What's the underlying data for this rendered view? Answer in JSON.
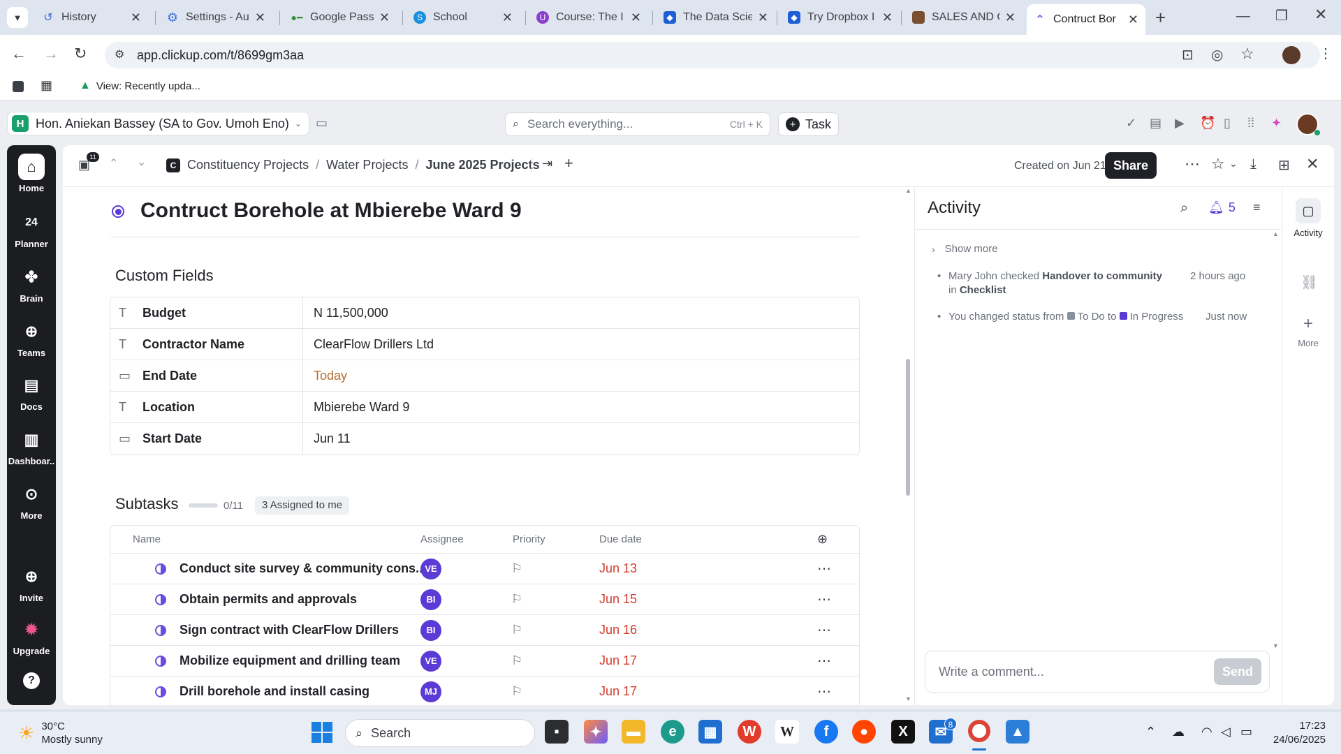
{
  "browser": {
    "tabs": [
      {
        "title": "History",
        "icon": "history-icon",
        "color": "#3b6fd9"
      },
      {
        "title": "Settings - Au",
        "icon": "gear-icon",
        "color": "#3b6fd9"
      },
      {
        "title": "Google Passw",
        "icon": "key-icon",
        "color": "#3c8d40"
      },
      {
        "title": "School",
        "icon": "skype-icon",
        "color": "#1a8fe0"
      },
      {
        "title": "Course: The I",
        "icon": "udemy-icon",
        "color": "#8b3fd1"
      },
      {
        "title": "The Data Scie",
        "icon": "dropbox-icon",
        "color": "#1f5fd6"
      },
      {
        "title": "Try Dropbox I",
        "icon": "dropbox-icon",
        "color": "#1f5fd6"
      },
      {
        "title": "SALES AND C",
        "icon": "portrait-icon",
        "color": "#7a4e2e"
      },
      {
        "title": "Contruct Bor",
        "icon": "clickup-icon",
        "color": "#7b68ee"
      }
    ],
    "new_tab": "+",
    "url": "app.clickup.com/t/8699gm3aa",
    "bookmark_label": "View: Recently upda..."
  },
  "topbar": {
    "workspace_initial": "H",
    "workspace_name": "Hon. Aniekan Bassey (SA to Gov. Umoh Eno)",
    "search_placeholder": "Search everything...",
    "search_shortcut": "Ctrl + K",
    "task_button": "Task"
  },
  "sidebar": {
    "items": [
      {
        "label": "Home",
        "icon": "home-icon"
      },
      {
        "label": "Planner",
        "icon": "calendar-24-icon"
      },
      {
        "label": "Brain",
        "icon": "brain-icon"
      },
      {
        "label": "Teams",
        "icon": "teams-icon"
      },
      {
        "label": "Docs",
        "icon": "doc-icon"
      },
      {
        "label": "Dashboar..",
        "icon": "dashboard-icon"
      },
      {
        "label": "More",
        "icon": "more-icon"
      },
      {
        "label": "Invite",
        "icon": "invite-icon"
      },
      {
        "label": "Upgrade",
        "icon": "upgrade-icon"
      }
    ],
    "notification_count": "11"
  },
  "breadcrumb": {
    "space_initial": "C",
    "items": [
      "Constituency Projects",
      "Water Projects",
      "June 2025 Projects"
    ],
    "created": "Created on Jun 21",
    "share": "Share"
  },
  "task": {
    "title": "Contruct Borehole at Mbierebe Ward 9",
    "custom_fields_heading": "Custom Fields",
    "custom_fields": [
      {
        "name": "Budget",
        "value": "N 11,500,000",
        "icon": "text-icon",
        "value_color": "#1f2126"
      },
      {
        "name": "Contractor Name",
        "value": "ClearFlow Drillers Ltd",
        "icon": "text-icon",
        "value_color": "#1f2126"
      },
      {
        "name": "End Date",
        "value": "Today",
        "icon": "calendar-icon",
        "value_color": "#b36b2c"
      },
      {
        "name": "Location",
        "value": "Mbierebe Ward 9",
        "icon": "text-icon",
        "value_color": "#1f2126"
      },
      {
        "name": "Start Date",
        "value": "Jun 11",
        "icon": "calendar-icon",
        "value_color": "#1f2126"
      }
    ],
    "subtasks_heading": "Subtasks",
    "subtasks_progress": "0/11",
    "subtasks_progress_fraction": 0,
    "assigned_to_me": "3 Assigned to me",
    "columns": {
      "name": "Name",
      "assignee": "Assignee",
      "priority": "Priority",
      "due": "Due date"
    },
    "subtasks": [
      {
        "name": "Conduct site survey & community cons...",
        "assignee": "VE",
        "due": "Jun 13"
      },
      {
        "name": "Obtain permits and approvals",
        "assignee": "BI",
        "due": "Jun 15"
      },
      {
        "name": "Sign contract with ClearFlow Drillers",
        "assignee": "BI",
        "due": "Jun 16"
      },
      {
        "name": "Mobilize equipment and drilling team",
        "assignee": "VE",
        "due": "Jun 17"
      },
      {
        "name": "Drill borehole and install casing",
        "assignee": "MJ",
        "due": "Jun 17"
      }
    ]
  },
  "activity": {
    "title": "Activity",
    "notification_count": "5",
    "show_more": "Show more",
    "entries": [
      {
        "actor": "Mary John checked ",
        "target": "Handover to community",
        "mid": " in ",
        "location": "Checklist",
        "time": "2 hours ago"
      },
      {
        "text": "You changed status from ",
        "from": "To Do",
        "to_word": " to ",
        "to": "In Progress",
        "time": "Just now"
      }
    ],
    "comment_placeholder": "Write a comment...",
    "send": "Send"
  },
  "rail": {
    "activity_label": "Activity",
    "more_label": "More"
  },
  "taskbar": {
    "temp": "30°C",
    "weather": "Mostly sunny",
    "search": "Search",
    "time": "17:23",
    "date": "24/06/2025",
    "mail_badge": "8"
  }
}
